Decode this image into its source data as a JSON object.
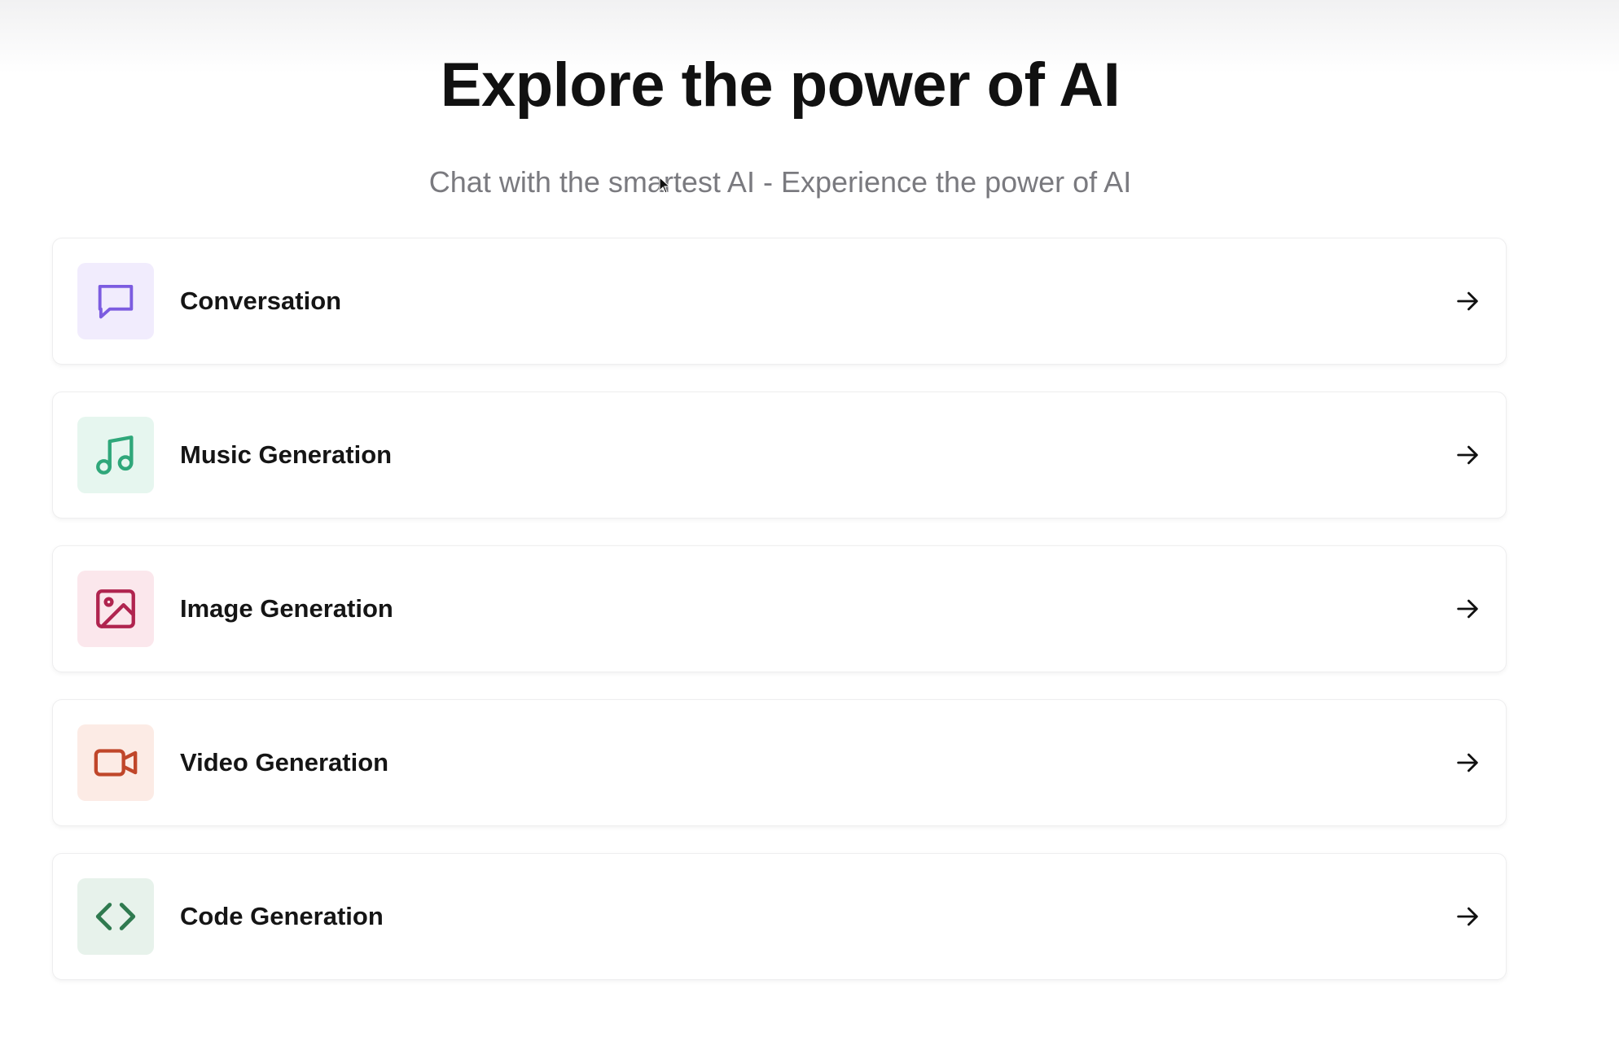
{
  "header": {
    "title": "Explore the power of AI",
    "subtitle": "Chat with the smartest AI - Experience the power of AI"
  },
  "features": [
    {
      "label": "Conversation",
      "icon": "chat-bubble-icon",
      "icon_color": "#7c5ce0",
      "tile_color": "#f1ecfd"
    },
    {
      "label": "Music Generation",
      "icon": "music-note-icon",
      "icon_color": "#2fa77a",
      "tile_color": "#e6f6ef"
    },
    {
      "label": "Image Generation",
      "icon": "image-icon",
      "icon_color": "#b0244f",
      "tile_color": "#fbe7ec"
    },
    {
      "label": "Video Generation",
      "icon": "video-camera-icon",
      "icon_color": "#c0462a",
      "tile_color": "#fcebe5"
    },
    {
      "label": "Code Generation",
      "icon": "code-icon",
      "icon_color": "#2f7a4f",
      "tile_color": "#e7f2eb"
    }
  ],
  "arrow_icon": "arrow-right-icon"
}
